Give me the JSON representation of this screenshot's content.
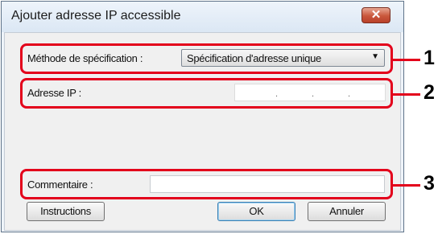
{
  "dialog": {
    "title": "Ajouter adresse IP accessible",
    "close_label": "✕"
  },
  "form": {
    "method_label": "Méthode de spécification :",
    "method_value": "Spécification d'adresse unique",
    "ip_label": "Adresse IP :",
    "ip_dot": ".",
    "comment_label": "Commentaire :",
    "comment_value": ""
  },
  "buttons": {
    "instructions": "Instructions",
    "ok": "OK",
    "cancel": "Annuler"
  },
  "callouts": [
    "1",
    "2",
    "3"
  ],
  "colors": {
    "callout": "#e3001b",
    "close": "#c9573b"
  },
  "icons": {
    "dropdown": "chevron-down-icon",
    "close": "close-icon"
  }
}
